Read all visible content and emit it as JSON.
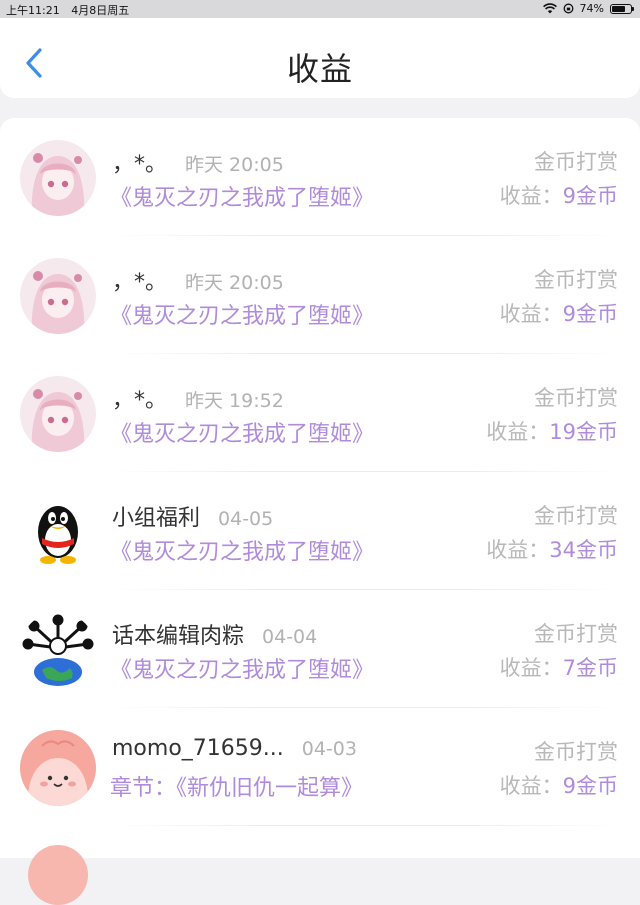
{
  "status_bar": {
    "time": "上午11:21",
    "date": "4月8日周五",
    "battery": "74%",
    "battery_level": 0.74
  },
  "header": {
    "title": "收益",
    "accent_color": "#3a8ee8"
  },
  "colors": {
    "purple": "#b08bdc",
    "gray": "#b8b8b8"
  },
  "rows": [
    {
      "name": "，*。",
      "time": "昨天 20:05",
      "work": "《鬼灭之刃之我成了堕姬》",
      "type": "金币打赏",
      "income_label": "收益：",
      "income_value": "9金币",
      "avatar": "anime-girl-avatar"
    },
    {
      "name": "，*。",
      "time": "昨天 20:05",
      "work": "《鬼灭之刃之我成了堕姬》",
      "type": "金币打赏",
      "income_label": "收益：",
      "income_value": "9金币",
      "avatar": "anime-girl-avatar"
    },
    {
      "name": "，*。",
      "time": "昨天 19:52",
      "work": "《鬼灭之刃之我成了堕姬》",
      "type": "金币打赏",
      "income_label": "收益：",
      "income_value": "19金币",
      "avatar": "anime-girl-avatar"
    },
    {
      "name": "小组福利",
      "time": "04-05",
      "work": "《鬼灭之刃之我成了堕姬》",
      "type": "金币打赏",
      "income_label": "收益：",
      "income_value": "34金币",
      "avatar": "penguin-avatar"
    },
    {
      "name": "话本编辑肉粽",
      "time": "04-04",
      "work": "《鬼灭之刃之我成了堕姬》",
      "type": "金币打赏",
      "income_label": "收益：",
      "income_value": "7金币",
      "avatar": "earth-avatar"
    },
    {
      "name": "momo_71659...",
      "time": "04-03",
      "work": "章节：《新仇旧仇一起算》",
      "type": "金币打赏",
      "income_label": "收益：",
      "income_value": "9金币",
      "avatar": "pink-blob-avatar"
    }
  ]
}
